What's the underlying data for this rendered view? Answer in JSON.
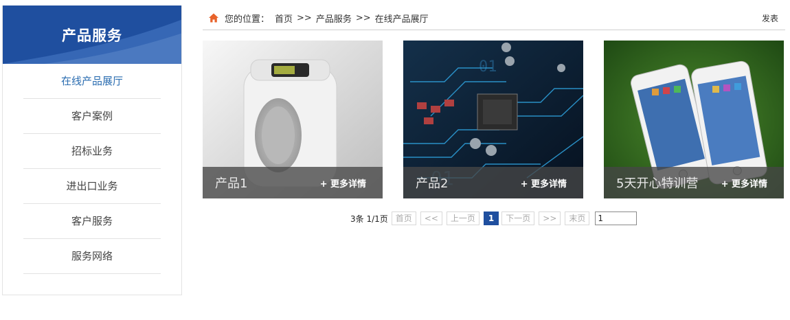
{
  "sidebar": {
    "title": "产品服务",
    "items": [
      {
        "label": "在线产品展厅",
        "active": true
      },
      {
        "label": "客户案例"
      },
      {
        "label": "招标业务"
      },
      {
        "label": "进出口业务"
      },
      {
        "label": "客户服务"
      },
      {
        "label": "服务网络"
      }
    ]
  },
  "breadcrumb": {
    "prefix": "您的位置：",
    "crumbs": [
      "首页",
      "产品服务",
      "在线产品展厅"
    ],
    "separator": ">>",
    "publish": "发表"
  },
  "products": [
    {
      "name": "产品1",
      "more": "+ 更多详情"
    },
    {
      "name": "产品2",
      "more": "+ 更多详情"
    },
    {
      "name": "5天开心特训营",
      "more": "+ 更多详情"
    }
  ],
  "pagination": {
    "info": "3条 1/1页",
    "first": "首页",
    "prev_prev": "<<",
    "prev": "上一页",
    "current": "1",
    "next": "下一页",
    "next_next": ">>",
    "last": "末页",
    "jump_value": "1"
  },
  "colors": {
    "brand_blue": "#1f4f9f",
    "active_link": "#2a6cb0",
    "home_icon": "#e8632b"
  }
}
